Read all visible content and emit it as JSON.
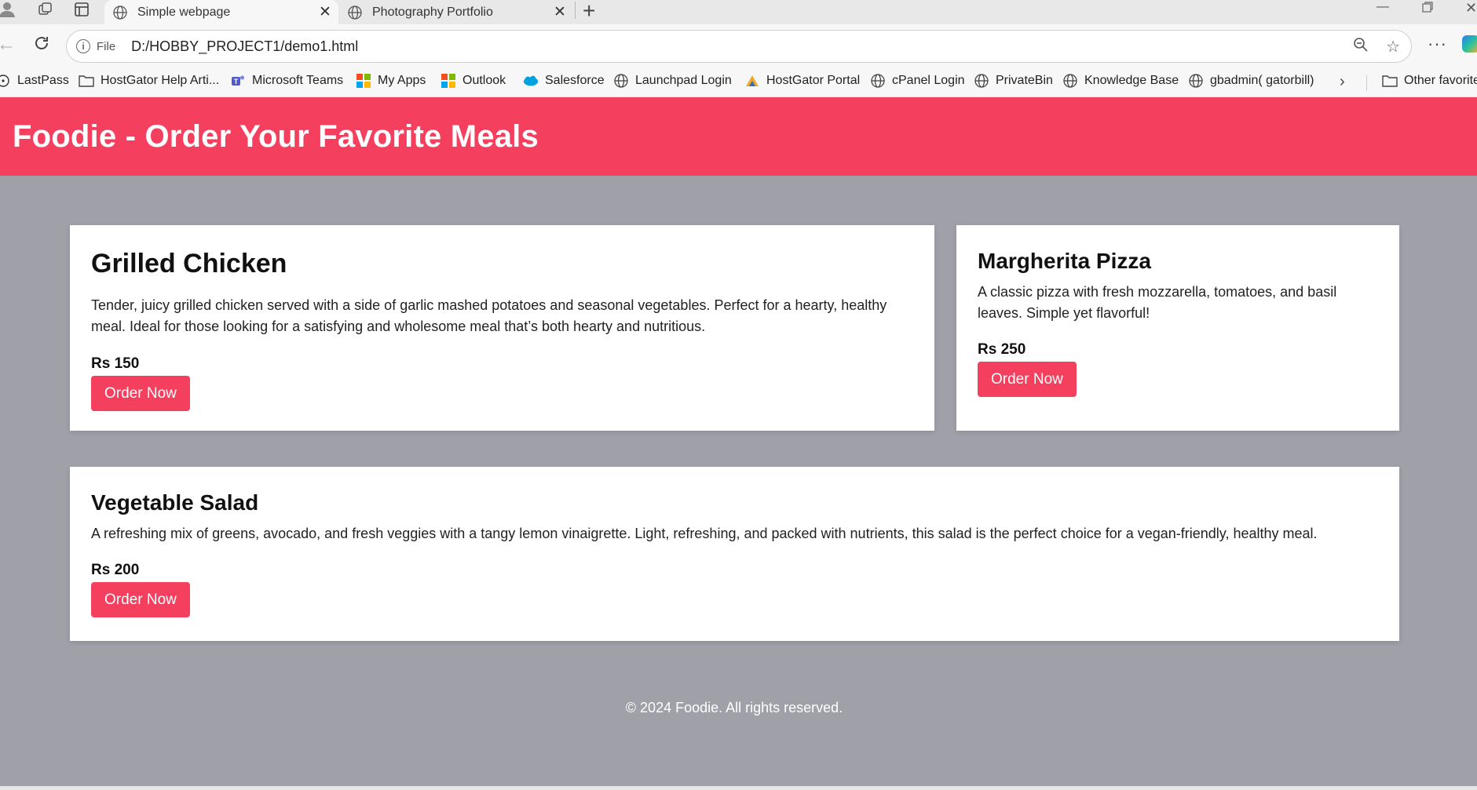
{
  "browser": {
    "tabs": [
      {
        "title": "Simple webpage",
        "active": true
      },
      {
        "title": "Photography Portfolio",
        "active": false
      }
    ],
    "address": {
      "scheme_label": "File",
      "url": "D:/HOBBY_PROJECT1/demo1.html"
    },
    "bookmarks": [
      {
        "label": "LastPass",
        "icon": "lastpass-icon"
      },
      {
        "label": "HostGator Help Arti...",
        "icon": "folder-icon"
      },
      {
        "label": "Microsoft Teams",
        "icon": "teams-icon"
      },
      {
        "label": "My Apps",
        "icon": "microsoft-icon"
      },
      {
        "label": "Outlook",
        "icon": "microsoft-icon"
      },
      {
        "label": "Salesforce",
        "icon": "salesforce-icon"
      },
      {
        "label": "Launchpad Login",
        "icon": "globe-icon"
      },
      {
        "label": "HostGator Portal",
        "icon": "hostgator-icon"
      },
      {
        "label": "cPanel Login",
        "icon": "globe-icon"
      },
      {
        "label": "PrivateBin",
        "icon": "globe-icon"
      },
      {
        "label": "Knowledge Base",
        "icon": "globe-icon"
      },
      {
        "label": "gbadmin( gatorbill)",
        "icon": "globe-icon"
      },
      {
        "label": "Other favorite",
        "icon": "folder-icon"
      }
    ]
  },
  "site": {
    "title": "Foodie - Order Your Favorite Meals",
    "accent": "#f43f5e",
    "background": "#9fa0a8",
    "cards": [
      {
        "name": "Grilled Chicken",
        "description": "Tender, juicy grilled chicken served with a side of garlic mashed potatoes and seasonal vegetables. Perfect for a hearty, healthy meal. Ideal for those looking for a satisfying and wholesome meal that’s both hearty and nutritious.",
        "price": "Rs 150",
        "button": "Order Now"
      },
      {
        "name": "Margherita Pizza",
        "description": "A classic pizza with fresh mozzarella, tomatoes, and basil leaves. Simple yet flavorful!",
        "price": "Rs 250",
        "button": "Order Now"
      },
      {
        "name": "Vegetable Salad",
        "description": "A refreshing mix of greens, avocado, and fresh veggies with a tangy lemon vinaigrette. Light, refreshing, and packed with nutrients, this salad is the perfect choice for a vegan-friendly, healthy meal.",
        "price": "Rs 200",
        "button": "Order Now"
      }
    ],
    "footer": "© 2024 Foodie. All rights reserved."
  }
}
